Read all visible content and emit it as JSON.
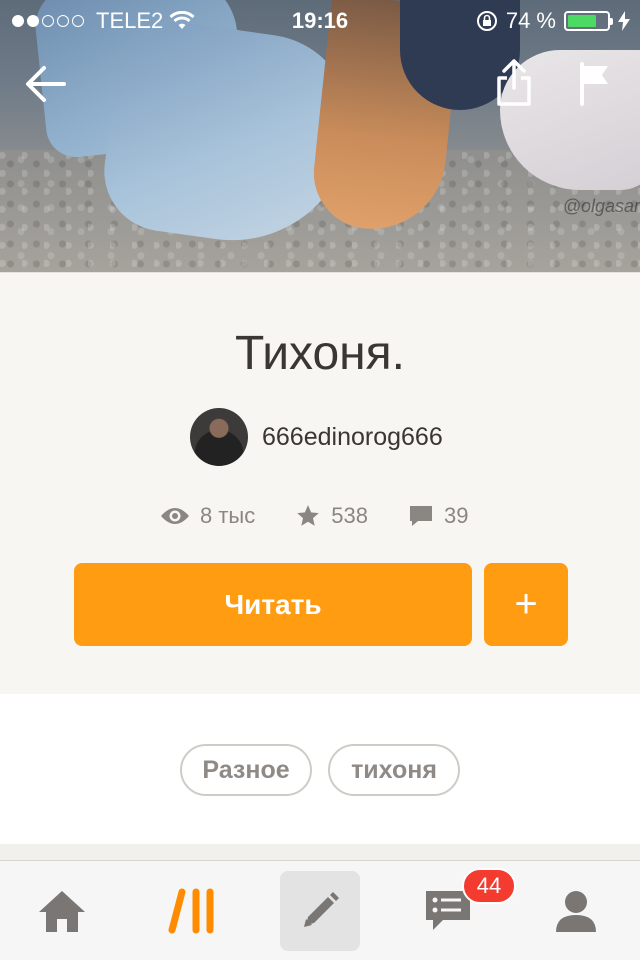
{
  "status_bar": {
    "carrier": "TELE2",
    "time": "19:16",
    "battery_percent": "74 %",
    "battery_level": 0.74,
    "signal_dots_filled": 2,
    "signal_dots_total": 5
  },
  "cover": {
    "watermark": "@olgasar"
  },
  "nav": {
    "back_icon": "arrow-left-icon",
    "share_icon": "share-icon",
    "report_icon": "flag-icon"
  },
  "story": {
    "title": "Тихоня.",
    "author": "666edinorog666",
    "views": "8 тыс",
    "votes": "538",
    "comments": "39"
  },
  "actions": {
    "read_label": "Читать",
    "add_label": "+"
  },
  "tags": [
    "Разное",
    "тихоня"
  ],
  "tabbar": {
    "items": [
      "home-icon",
      "library-icon",
      "write-icon",
      "messages-icon",
      "profile-icon"
    ],
    "messages_badge": "44"
  },
  "colors": {
    "accent": "#ff9c12",
    "badge": "#f43b30",
    "battery": "#4cd964"
  }
}
